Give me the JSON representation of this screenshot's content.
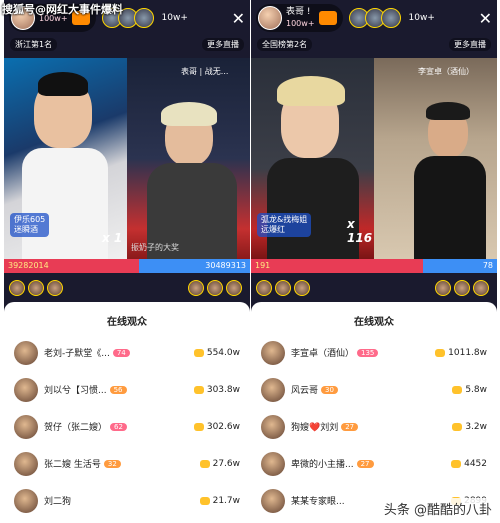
{
  "watermark": {
    "top_left": "搜狐号@网红大事件爆料",
    "bottom_right": "头条 @酷酷的八卦"
  },
  "left": {
    "host_name": "",
    "host_likes": "100w+",
    "viewer_count": "10w+",
    "rank": "浙江第1名",
    "more_live": "更多直播",
    "video_label": "表哥 | 战无...",
    "left_tag_name": "伊乐605",
    "left_tag_sub": "迷瞬酒",
    "multiplier": "x 1",
    "gift_text": "振奶子的大奖",
    "pk_left": "3928​2014",
    "pk_right": "30489313",
    "panel_title": "在线观众",
    "rows": [
      {
        "name": "老刘-子默堂《...",
        "badge": "74",
        "score": "554.0w"
      },
      {
        "name": "刘以兮【习惯...",
        "badge": "56",
        "score": "303.8w"
      },
      {
        "name": "贺仔（张二嫂）",
        "badge": "62",
        "score": "302.6w"
      },
      {
        "name": "张二嫂 生活号",
        "badge": "32",
        "score": "27.6w"
      },
      {
        "name": "刘二狗",
        "badge": "",
        "score": "21.7w"
      }
    ]
  },
  "right": {
    "host_name": "表哥 !",
    "host_likes": "100w+",
    "viewer_count": "10w+",
    "rank": "全国榜第2名",
    "more_live": "更多直播",
    "video_label": "李宣卓（酒仙）",
    "left_tag_name": "弧龙&找梅姐",
    "left_tag_sub": "远爆红",
    "multiplier": "x 116",
    "pk_left": "191",
    "pk_right": "78",
    "panel_title": "在线观众",
    "rows": [
      {
        "name": "李宣卓（酒仙）",
        "badge": "135",
        "score": "1011.8w"
      },
      {
        "name": "风云哥",
        "badge": "30",
        "score": "5.8w"
      },
      {
        "name": "狗嫂❤️刘刘",
        "badge": "27",
        "score": "3.2w"
      },
      {
        "name": "卑微的小主播...",
        "badge": "27",
        "score": "4452"
      },
      {
        "name": "某某专家眼...",
        "badge": "",
        "score": "2899"
      }
    ]
  },
  "colors": {
    "pk_red": "#e83c55",
    "pk_blue": "#3d8ff5",
    "coin": "#ffc22b"
  },
  "icons": [
    "close-icon",
    "coin-icon",
    "gift-icon"
  ]
}
